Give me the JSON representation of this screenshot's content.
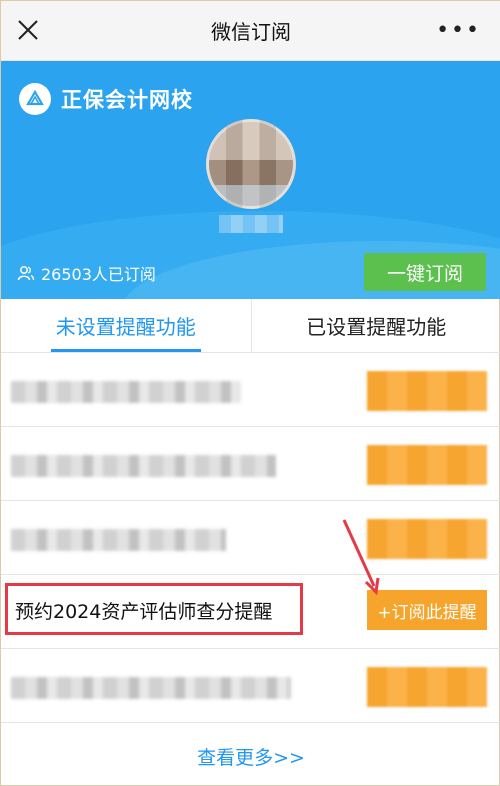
{
  "topbar": {
    "title": "微信订阅",
    "more_label": "•••"
  },
  "banner": {
    "brand_name": "正保会计网校",
    "subscriber_count": "26503人已订阅",
    "subscribe_all_label": "一键订阅"
  },
  "tabs": [
    {
      "label": "未设置提醒功能",
      "active": true
    },
    {
      "label": "已设置提醒功能",
      "active": false
    }
  ],
  "list": {
    "visible_item_title": "预约2024资产评估师查分提醒",
    "visible_item_button": "+订阅此提醒"
  },
  "footer": {
    "more_label": "查看更多>>"
  },
  "colors": {
    "accent_blue": "#2196f3",
    "banner_blue": "#2ca3ee",
    "green_button": "#5cc04e",
    "orange_button": "#f6a42c",
    "highlight_red": "#e63946"
  }
}
